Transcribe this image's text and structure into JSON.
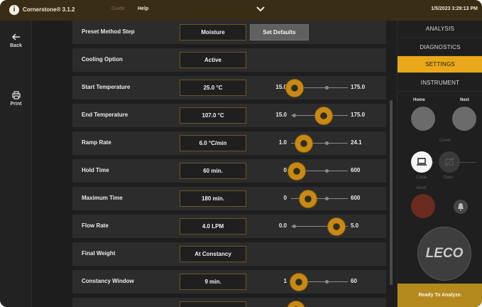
{
  "titlebar": {
    "info_icon": "i",
    "app_title": "Cornerstone® 3.1.2",
    "guide": "Guide",
    "help": "Help",
    "datetime": "1/5/2023 3:29:13 PM"
  },
  "left_rail": {
    "back_label": "Back",
    "print_label": "Print"
  },
  "rows": [
    {
      "label": "Preset Method Step",
      "value": "Moisture",
      "button": "Set Defaults"
    },
    {
      "label": "Cooling Option",
      "value": "Active"
    },
    {
      "label": "Start Temperature",
      "value": "25.0 °C",
      "min": "15.0",
      "max": "175.0",
      "position": 0.06
    },
    {
      "label": "End Temperature",
      "value": "107.0 °C",
      "min": "15.0",
      "max": "175.0",
      "position": 0.58
    },
    {
      "label": "Ramp Rate",
      "value": "6.0 °C/min",
      "min": "1.0",
      "max": "24.1",
      "position": 0.22
    },
    {
      "label": "Hold Time",
      "value": "60 min.",
      "min": "0",
      "max": "600",
      "position": 0.1
    },
    {
      "label": "Maximum Time",
      "value": "180 min.",
      "min": "0",
      "max": "600",
      "position": 0.3
    },
    {
      "label": "Flow Rate",
      "value": "4.0 LPM",
      "min": "0.0",
      "max": "5.0",
      "position": 0.8
    },
    {
      "label": "Final Weight",
      "value": "At Constancy"
    },
    {
      "label": "Constancy Window",
      "value": "9 min.",
      "min": "1",
      "max": "60",
      "position": 0.14
    }
  ],
  "right_panel": {
    "tabs": [
      "ANALYSIS",
      "DIAGNOSTICS",
      "SETTINGS",
      "INSTRUMENT"
    ],
    "active_tab": "SETTINGS",
    "home_label": "Home",
    "next_label": "Next",
    "cover_label": "Cover",
    "close_label": "Close",
    "open_label": "Open",
    "abort_label": "Abort",
    "logo_text": "LECO",
    "status": "Ready To Analyze."
  },
  "colors": {
    "accent": "#e9a819",
    "titlebar": "#3a2d16",
    "abort": "#6b2a1f",
    "row_bg": "#2c2c2c"
  }
}
